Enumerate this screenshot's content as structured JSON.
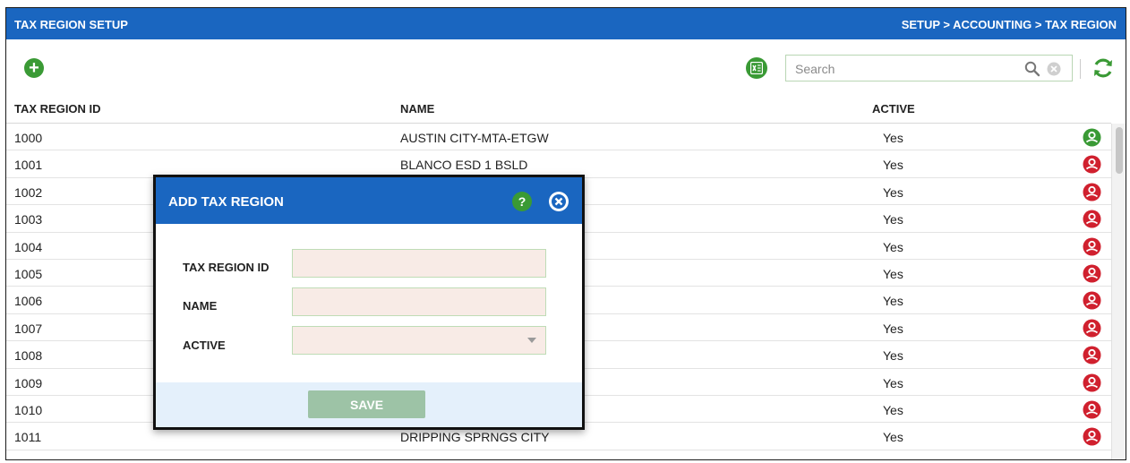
{
  "header": {
    "title": "TAX REGION SETUP",
    "breadcrumb": "SETUP > ACCOUNTING > TAX REGION"
  },
  "toolbar": {
    "add_icon": "plus-circle-icon",
    "excel_icon": "excel-export-icon",
    "search_placeholder": "Search",
    "search_value": "",
    "refresh_icon": "refresh-icon"
  },
  "table": {
    "columns": [
      "TAX REGION ID",
      "NAME",
      "ACTIVE"
    ],
    "rows": [
      {
        "id": "1000",
        "name": "AUSTIN CITY-MTA-ETGW",
        "active": "Yes",
        "status": "green"
      },
      {
        "id": "1001",
        "name": "BLANCO ESD 1 BSLD",
        "active": "Yes",
        "status": "red"
      },
      {
        "id": "1002",
        "name": "",
        "active": "Yes",
        "status": "red"
      },
      {
        "id": "1003",
        "name": "",
        "active": "Yes",
        "status": "red"
      },
      {
        "id": "1004",
        "name": "",
        "active": "Yes",
        "status": "red"
      },
      {
        "id": "1005",
        "name": "",
        "active": "Yes",
        "status": "red"
      },
      {
        "id": "1006",
        "name": "",
        "active": "Yes",
        "status": "red"
      },
      {
        "id": "1007",
        "name": "",
        "active": "Yes",
        "status": "red"
      },
      {
        "id": "1008",
        "name": "",
        "active": "Yes",
        "status": "red"
      },
      {
        "id": "1009",
        "name": "",
        "active": "Yes",
        "status": "red"
      },
      {
        "id": "1010",
        "name": "",
        "active": "Yes",
        "status": "red"
      },
      {
        "id": "1011",
        "name": "DRIPPING SPRNGS CITY",
        "active": "Yes",
        "status": "red"
      }
    ]
  },
  "modal": {
    "title": "ADD TAX REGION",
    "help_label": "?",
    "fields": [
      {
        "label": "TAX REGION ID",
        "value": ""
      },
      {
        "label": "NAME",
        "value": ""
      },
      {
        "label": "ACTIVE",
        "value": ""
      }
    ],
    "save_label": "SAVE"
  },
  "colors": {
    "header_blue": "#1a66c0",
    "accent_green": "#3a9a35",
    "status_red": "#d0202e",
    "status_green": "#3a9a35",
    "input_bg": "#f8ebe6",
    "save_disabled": "#9dc3a6"
  }
}
